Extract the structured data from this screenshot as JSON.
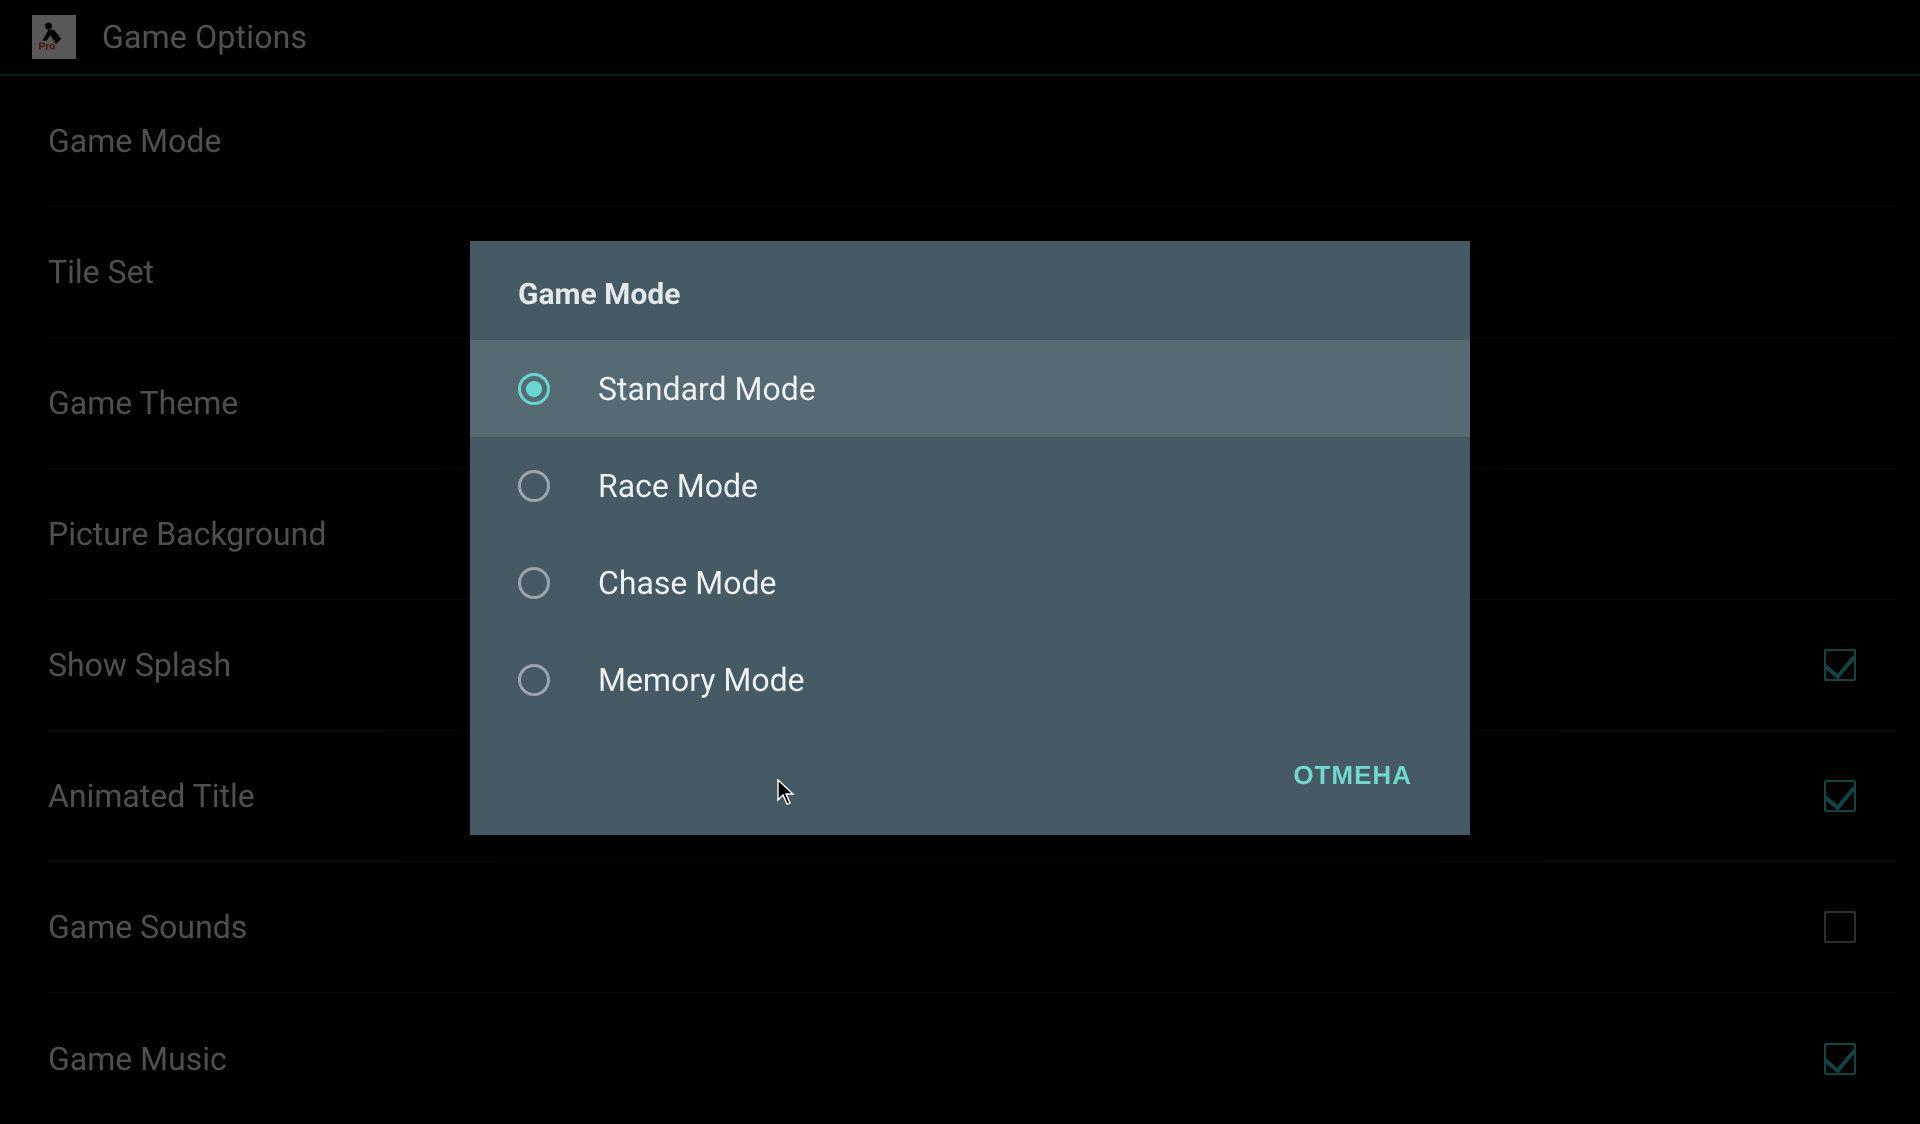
{
  "header": {
    "title": "Game Options"
  },
  "settings": {
    "items": [
      {
        "label": "Game Mode",
        "has_checkbox": false
      },
      {
        "label": "Tile Set",
        "has_checkbox": false
      },
      {
        "label": "Game Theme",
        "has_checkbox": false
      },
      {
        "label": "Picture Background",
        "has_checkbox": false
      },
      {
        "label": "Show Splash",
        "has_checkbox": true,
        "checked": true
      },
      {
        "label": "Animated Title",
        "has_checkbox": true,
        "checked": true
      },
      {
        "label": "Game Sounds",
        "has_checkbox": true,
        "checked": false
      },
      {
        "label": "Game Music",
        "has_checkbox": true,
        "checked": true
      }
    ]
  },
  "dialog": {
    "title": "Game Mode",
    "options": [
      {
        "label": "Standard Mode",
        "selected": true
      },
      {
        "label": "Race Mode",
        "selected": false
      },
      {
        "label": "Chase Mode",
        "selected": false
      },
      {
        "label": "Memory Mode",
        "selected": false
      }
    ],
    "cancel_label": "ОТМЕНА"
  }
}
